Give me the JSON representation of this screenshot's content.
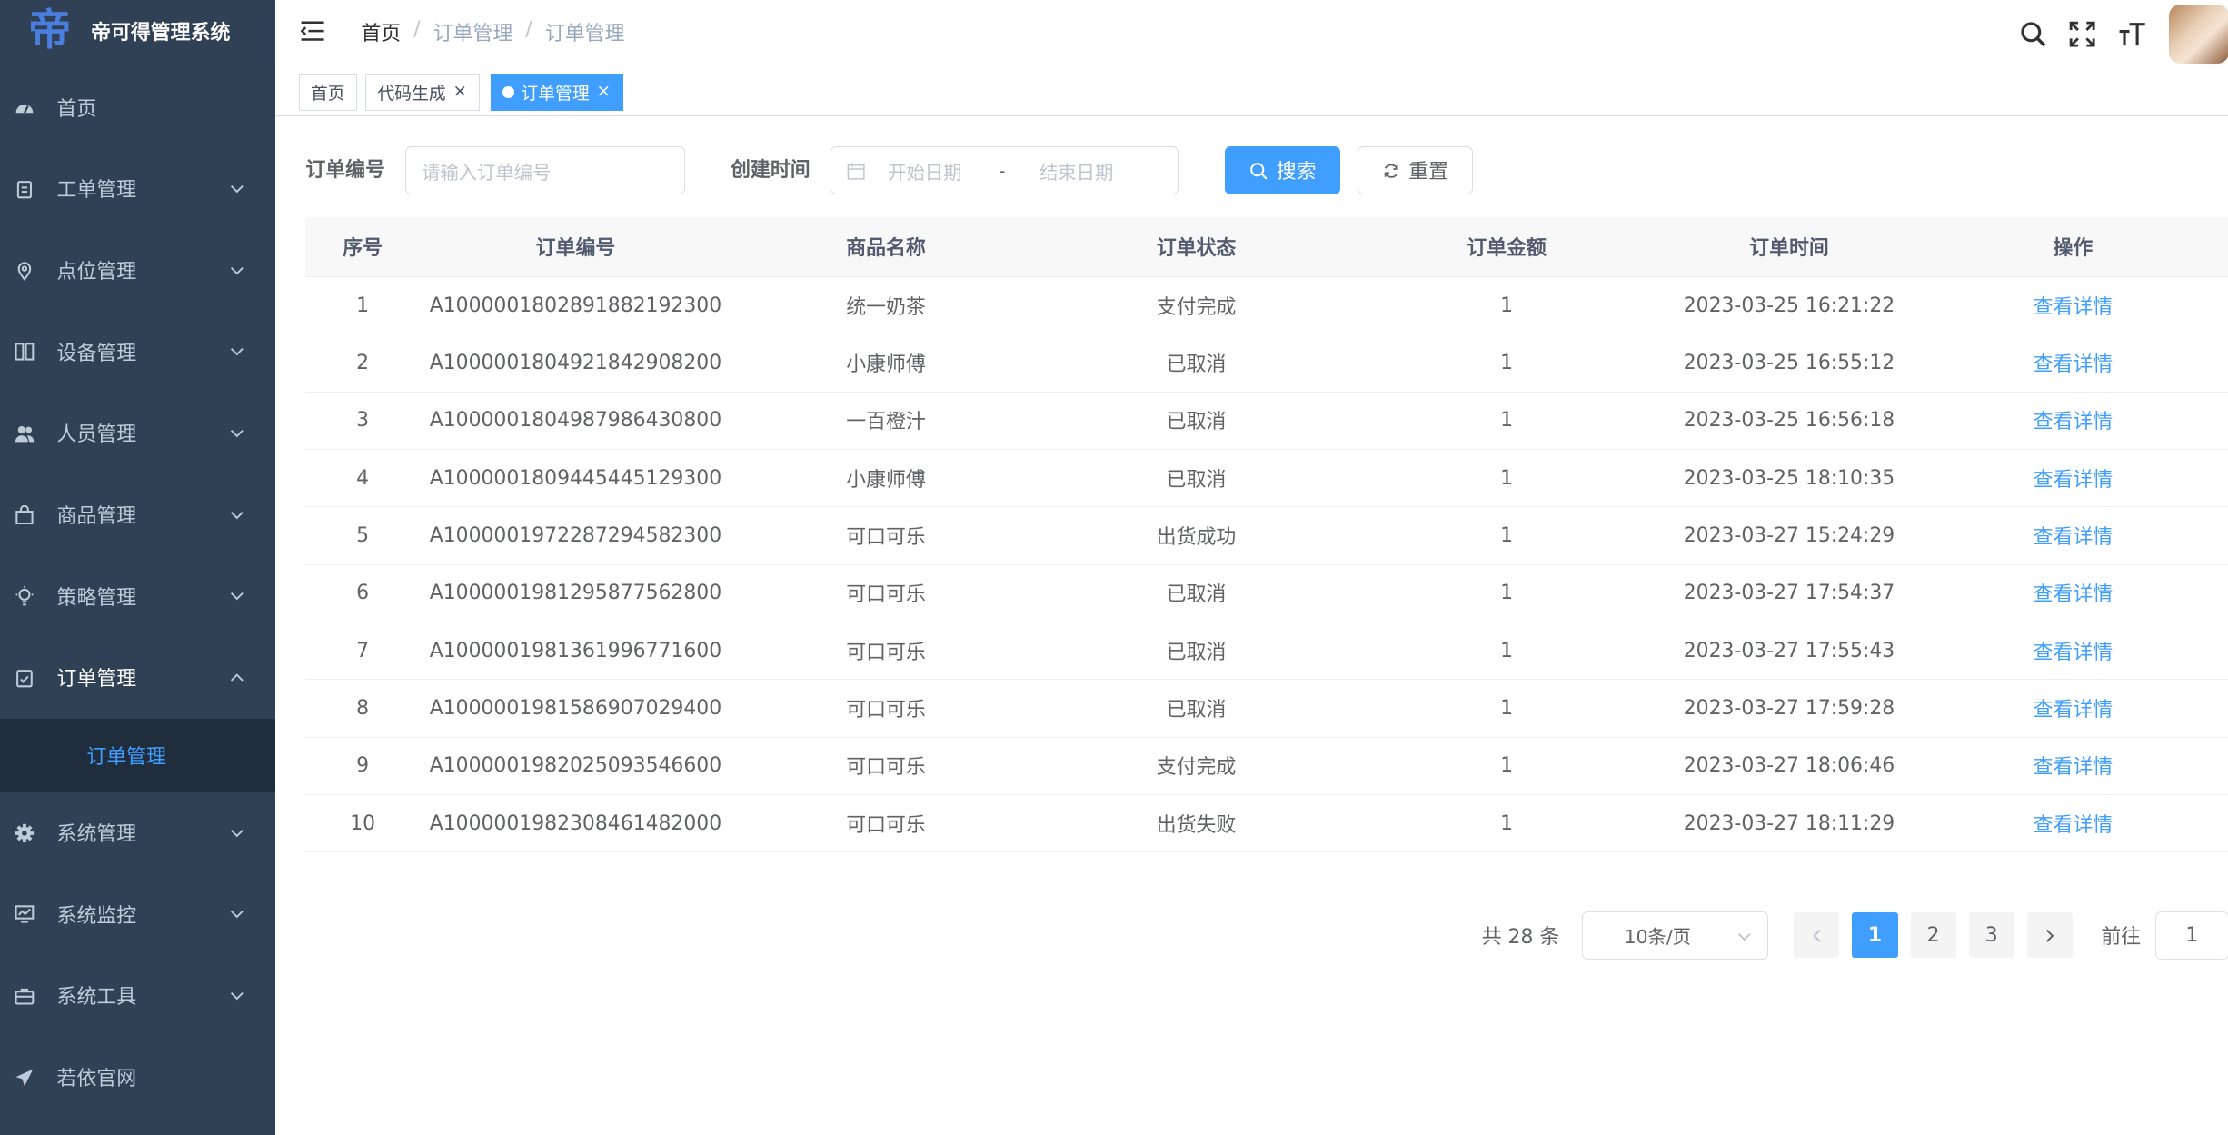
{
  "app": {
    "title": "帝可得管理系统",
    "logo_glyph": "帝"
  },
  "sidebar": {
    "items": [
      {
        "label": "首页",
        "icon": "dashboard-icon"
      },
      {
        "label": "工单管理",
        "icon": "clipboard-icon"
      },
      {
        "label": "点位管理",
        "icon": "location-icon"
      },
      {
        "label": "设备管理",
        "icon": "device-icon"
      },
      {
        "label": "人员管理",
        "icon": "people-icon"
      },
      {
        "label": "商品管理",
        "icon": "shopping-bag-icon"
      },
      {
        "label": "策略管理",
        "icon": "bulb-icon"
      },
      {
        "label": "订单管理",
        "icon": "order-icon",
        "expanded": true
      },
      {
        "label": "系统管理",
        "icon": "gear-icon"
      },
      {
        "label": "系统监控",
        "icon": "monitor-icon"
      },
      {
        "label": "系统工具",
        "icon": "toolbox-icon"
      },
      {
        "label": "若依官网",
        "icon": "send-icon"
      }
    ],
    "submenu_label": "订单管理"
  },
  "header": {
    "breadcrumb": [
      "首页",
      "订单管理",
      "订单管理"
    ],
    "separator": "/"
  },
  "tags": [
    {
      "label": "首页"
    },
    {
      "label": "代码生成",
      "closable": true
    },
    {
      "label": "订单管理",
      "closable": true,
      "active": true
    }
  ],
  "search_form": {
    "order_no_label": "订单编号",
    "order_no_placeholder": "请输入订单编号",
    "created_time_label": "创建时间",
    "start_placeholder": "开始日期",
    "range_separator": "-",
    "end_placeholder": "结束日期",
    "search_button": "搜索",
    "reset_button": "重置"
  },
  "table": {
    "columns": [
      "序号",
      "订单编号",
      "商品名称",
      "订单状态",
      "订单金额",
      "订单时间",
      "操作"
    ],
    "rows": [
      [
        "1",
        "A1000001802891882192300",
        "统一奶茶",
        "支付完成",
        "1",
        "2023-03-25 16:21:22",
        "查看详情"
      ],
      [
        "2",
        "A1000001804921842908200",
        "小康师傅",
        "已取消",
        "1",
        "2023-03-25 16:55:12",
        "查看详情"
      ],
      [
        "3",
        "A1000001804987986430800",
        "一百橙汁",
        "已取消",
        "1",
        "2023-03-25 16:56:18",
        "查看详情"
      ],
      [
        "4",
        "A1000001809445445129300",
        "小康师傅",
        "已取消",
        "1",
        "2023-03-25 18:10:35",
        "查看详情"
      ],
      [
        "5",
        "A1000001972287294582300",
        "可口可乐",
        "出货成功",
        "1",
        "2023-03-27 15:24:29",
        "查看详情"
      ],
      [
        "6",
        "A1000001981295877562800",
        "可口可乐",
        "已取消",
        "1",
        "2023-03-27 17:54:37",
        "查看详情"
      ],
      [
        "7",
        "A1000001981361996771600",
        "可口可乐",
        "已取消",
        "1",
        "2023-03-27 17:55:43",
        "查看详情"
      ],
      [
        "8",
        "A1000001981586907029400",
        "可口可乐",
        "已取消",
        "1",
        "2023-03-27 17:59:28",
        "查看详情"
      ],
      [
        "9",
        "A1000001982025093546600",
        "可口可乐",
        "支付完成",
        "1",
        "2023-03-27 18:06:46",
        "查看详情"
      ],
      [
        "10",
        "A1000001982308461482000",
        "可口可乐",
        "出货失败",
        "1",
        "2023-03-27 18:11:29",
        "查看详情"
      ]
    ]
  },
  "pagination": {
    "total_text": "共 28 条",
    "page_size": "10条/页",
    "pages": [
      "1",
      "2",
      "3"
    ],
    "current": "1",
    "goto_label": "前往",
    "goto_value": "1"
  },
  "colors": {
    "sidebar_bg": "#304156",
    "accent": "#409eff",
    "submenu_bg": "#1f2d3d"
  }
}
